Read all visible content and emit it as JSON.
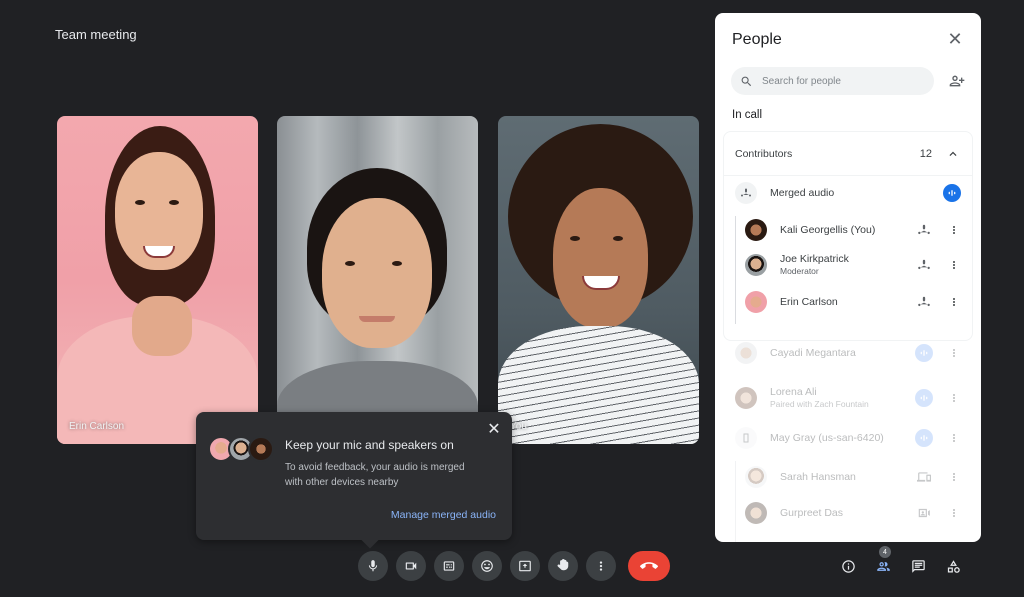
{
  "meeting": {
    "title": "Team meeting"
  },
  "tiles": [
    {
      "name": "Erin Carlson",
      "label": "Erin Carlson"
    },
    {
      "name": "Joe Kirkpatrick",
      "label": ""
    },
    {
      "name": "Kali Georgellis",
      "label": "You"
    }
  ],
  "toast": {
    "title": "Keep your mic and speakers on",
    "body": "To avoid feedback, your audio is merged with other devices nearby",
    "link": "Manage merged audio",
    "close_icon": "close-icon"
  },
  "controls": {
    "buttons": [
      {
        "name": "microphone",
        "icon": "mic-icon"
      },
      {
        "name": "camera",
        "icon": "videocam-icon"
      },
      {
        "name": "captions",
        "icon": "closed-captions-icon"
      },
      {
        "name": "reactions",
        "icon": "emoji-icon"
      },
      {
        "name": "present",
        "icon": "present-screen-icon"
      },
      {
        "name": "raise-hand",
        "icon": "hand-icon"
      },
      {
        "name": "more-options",
        "icon": "more-vert-icon"
      }
    ],
    "end_call": {
      "icon": "call-end-icon",
      "color": "#ea4335"
    }
  },
  "right_controls": {
    "info_icon": "info-icon",
    "people_icon": "people-icon",
    "people_badge": "4",
    "chat_icon": "chat-icon",
    "activities_icon": "activities-icon"
  },
  "panel": {
    "title": "People",
    "search_placeholder": "Search for people",
    "section_label": "In call",
    "contributors": {
      "label": "Contributors",
      "count": "12",
      "expanded": true
    },
    "merged_audio": {
      "label": "Merged audio"
    },
    "merged_members": [
      {
        "name": "Kali Georgellis (You)",
        "sub": ""
      },
      {
        "name": "Joe Kirkpatrick",
        "sub": "Moderator"
      },
      {
        "name": "Erin Carlson",
        "sub": ""
      }
    ],
    "others": [
      {
        "name": "Cayadi Megantara",
        "sub": ""
      },
      {
        "name": "Lorena Ali",
        "sub": "Paired with  Zach Fountain"
      },
      {
        "name": "May Gray (us-san-6420)",
        "sub": ""
      }
    ],
    "room_members": [
      {
        "name": "Sarah Hansman",
        "icon": "companion-mode-icon"
      },
      {
        "name": "Gurpreet Das",
        "icon": "video-frame-icon"
      }
    ]
  },
  "colors": {
    "background": "#202124",
    "accent": "#1a73e8",
    "link": "#8ab4f8",
    "end_call": "#ea4335"
  }
}
